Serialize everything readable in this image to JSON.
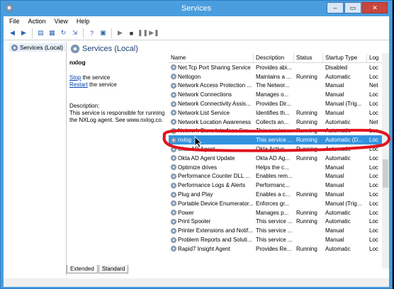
{
  "window": {
    "title": "Services",
    "min": "–",
    "max": "▭",
    "close": "✕"
  },
  "menu": [
    "File",
    "Action",
    "View",
    "Help"
  ],
  "tree": {
    "root": "Services (Local)"
  },
  "panel": {
    "header": "Services (Local)",
    "service_name": "nxlog",
    "stop_link": "Stop",
    "stop_rest": " the service",
    "restart_link": "Restart",
    "restart_rest": " the service",
    "description_label": "Description:",
    "description_text": "This service is responsible for running the NXLog agent. See www.nxlog.co."
  },
  "columns": [
    "Name",
    "Description",
    "Status",
    "Startup Type",
    "Log"
  ],
  "rows": [
    {
      "name": "Net.Tcp Port Sharing Service",
      "desc": "Provides abi...",
      "status": "",
      "type": "Disabled",
      "log": "Loc"
    },
    {
      "name": "Netlogon",
      "desc": "Maintains a ...",
      "status": "Running",
      "type": "Automatic",
      "log": "Loc"
    },
    {
      "name": "Network Access Protection ...",
      "desc": "The Networ...",
      "status": "",
      "type": "Manual",
      "log": "Net"
    },
    {
      "name": "Network Connections",
      "desc": "Manages o...",
      "status": "",
      "type": "Manual",
      "log": "Loc"
    },
    {
      "name": "Network Connectivity Assis...",
      "desc": "Provides Dir...",
      "status": "",
      "type": "Manual (Trig...",
      "log": "Loc"
    },
    {
      "name": "Network List Service",
      "desc": "Identifies th...",
      "status": "Running",
      "type": "Manual",
      "log": "Loc"
    },
    {
      "name": "Network Location Awareness",
      "desc": "Collects an...",
      "status": "Running",
      "type": "Automatic",
      "log": "Net"
    },
    {
      "name": "Network Store Interface Ser...",
      "desc": "This service ...",
      "status": "Running",
      "type": "Automatic",
      "log": "Loc"
    },
    {
      "name": "nxlog",
      "desc": "This service ...",
      "status": "Running",
      "type": "Automatic (D...",
      "log": "Loc"
    },
    {
      "name": "Okta AD Agent",
      "desc": "Okta Active ...",
      "status": "Running",
      "type": "Automatic",
      "log": "Loc"
    },
    {
      "name": "Okta AD Agent Update",
      "desc": "Okta AD Ag...",
      "status": "Running",
      "type": "Automatic",
      "log": "Loc"
    },
    {
      "name": "Optimize drives",
      "desc": "Helps the c...",
      "status": "",
      "type": "Manual",
      "log": "Loc"
    },
    {
      "name": "Performance Counter DLL ...",
      "desc": "Enables rem...",
      "status": "",
      "type": "Manual",
      "log": "Loc"
    },
    {
      "name": "Performance Logs & Alerts",
      "desc": "Performanc...",
      "status": "",
      "type": "Manual",
      "log": "Loc"
    },
    {
      "name": "Plug and Play",
      "desc": "Enables a c...",
      "status": "Running",
      "type": "Manual",
      "log": "Loc"
    },
    {
      "name": "Portable Device Enumerator...",
      "desc": "Enforces gr...",
      "status": "",
      "type": "Manual (Trig...",
      "log": "Loc"
    },
    {
      "name": "Power",
      "desc": "Manages p...",
      "status": "Running",
      "type": "Automatic",
      "log": "Loc"
    },
    {
      "name": "Print Spooler",
      "desc": "This service ...",
      "status": "Running",
      "type": "Automatic",
      "log": "Loc"
    },
    {
      "name": "Printer Extensions and Notif...",
      "desc": "This service ...",
      "status": "",
      "type": "Manual",
      "log": "Loc"
    },
    {
      "name": "Problem Reports and Soluti...",
      "desc": "This service ...",
      "status": "",
      "type": "Manual",
      "log": "Loc"
    },
    {
      "name": "Rapid7 Insight Agent",
      "desc": "Provides Re...",
      "status": "Running",
      "type": "Automatic",
      "log": "Loc"
    }
  ],
  "selected_row": 8,
  "tabs": [
    "Extended",
    "Standard"
  ],
  "colors": {
    "selection": "#3393df",
    "annotation": "#e0141e",
    "titlebar": "#4a9ede"
  }
}
